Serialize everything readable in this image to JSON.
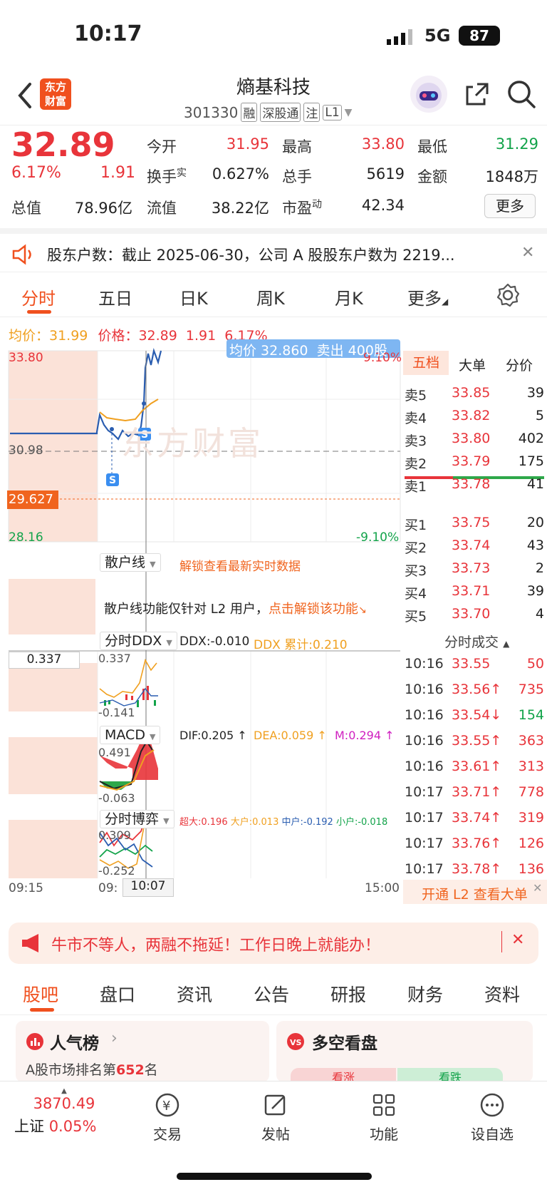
{
  "status_bar": {
    "time": "10:17",
    "network": "5G",
    "battery": "87"
  },
  "header": {
    "title": "熵基科技",
    "code": "301330",
    "tags": [
      "融",
      "深股通",
      "注",
      "L1"
    ],
    "logo_line1": "东方",
    "logo_line2": "财富"
  },
  "quote": {
    "price": "32.89",
    "change_pct": "6.17%",
    "change": "1.91",
    "fields": [
      {
        "label": "今开",
        "value": "31.95"
      },
      {
        "label": "最高",
        "value": "33.80"
      },
      {
        "label": "最低",
        "value": "31.29"
      },
      {
        "label": "换手",
        "sup": "实",
        "value": "0.627%"
      },
      {
        "label": "总手",
        "value": "5619"
      },
      {
        "label": "金额",
        "value": "1848万"
      },
      {
        "label": "总值",
        "value": "78.96亿"
      },
      {
        "label": "流值",
        "value": "38.22亿"
      },
      {
        "label": "市盈",
        "sup": "动",
        "value": "42.34"
      }
    ],
    "more_label": "更多"
  },
  "notice": {
    "text": "股东户数：截止 2025-06-30，公司 A 股股东户数为 2219..."
  },
  "chart_tabs": [
    "分时",
    "五日",
    "日K",
    "周K",
    "月K",
    "更多"
  ],
  "chart": {
    "avg_label": "均价：31.99",
    "price_label": "价格：32.89",
    "change": "1.91",
    "change_pct": "6.17%",
    "y_high": "33.80",
    "y_mid": "30.98",
    "y_low": "28.16",
    "pct_high": "9.10%",
    "pct_low": "-9.10%",
    "marker_price": "29.627",
    "tooltip": "均价 32.860  卖出 400股",
    "watermark": "东方财富",
    "retail_line_label": "散户线",
    "retail_unlock": "解锁查看最新实时数据",
    "retail_msg": "散户线功能仅针对 L2 用户，",
    "retail_msg_link": "点击解锁该功能",
    "ddx_label": "分时DDX",
    "ddx_value": "DDX:-0.010",
    "ddx_sum": "DDX 累计:0.210",
    "ddx_top": "0.337",
    "ddx_bottom": "-0.141",
    "macd_label": "MACD",
    "dif": "DIF:0.205 ↑",
    "dea": "DEA:0.059 ↑",
    "m": "M:0.294 ↑",
    "macd_top": "0.491",
    "macd_bottom": "-0.063",
    "game_label": "分时博弈",
    "game_values": [
      {
        "text": "超大:0.196",
        "color": "#e8343a"
      },
      {
        "text": "大户:0.013",
        "color": "#f0a020"
      },
      {
        "text": "中户:-0.192",
        "color": "#2a5db0"
      },
      {
        "text": "小户:-0.018",
        "color": "#12a34a"
      }
    ],
    "game_top": "0.309",
    "game_bottom": "-0.252",
    "time_start": "09:15",
    "time_mid": "09:",
    "time_cursor": "10:07",
    "time_end": "15:00"
  },
  "orderbook": {
    "tabs": [
      "五档",
      "大单",
      "分价"
    ],
    "sells": [
      {
        "label": "卖5",
        "price": "33.85",
        "vol": "39"
      },
      {
        "label": "卖4",
        "price": "33.82",
        "vol": "5"
      },
      {
        "label": "卖3",
        "price": "33.80",
        "vol": "402"
      },
      {
        "label": "卖2",
        "price": "33.79",
        "vol": "175"
      },
      {
        "label": "卖1",
        "price": "33.78",
        "vol": "41"
      }
    ],
    "buys": [
      {
        "label": "买1",
        "price": "33.75",
        "vol": "20"
      },
      {
        "label": "买2",
        "price": "33.74",
        "vol": "43"
      },
      {
        "label": "买3",
        "price": "33.73",
        "vol": "2"
      },
      {
        "label": "买4",
        "price": "33.71",
        "vol": "39"
      },
      {
        "label": "买5",
        "price": "33.70",
        "vol": "4"
      }
    ],
    "trades_title": "分时成交",
    "trades": [
      {
        "time": "10:16",
        "price": "33.55",
        "vol": "50",
        "vc": "red"
      },
      {
        "time": "10:16",
        "price": "33.56↑",
        "vol": "735",
        "vc": "red"
      },
      {
        "time": "10:16",
        "price": "33.54↓",
        "vol": "154",
        "vc": "green"
      },
      {
        "time": "10:16",
        "price": "33.55↑",
        "vol": "363",
        "vc": "red"
      },
      {
        "time": "10:16",
        "price": "33.61↑",
        "vol": "313",
        "vc": "red"
      },
      {
        "time": "10:17",
        "price": "33.71↑",
        "vol": "778",
        "vc": "red"
      },
      {
        "time": "10:17",
        "price": "33.74↑",
        "vol": "319",
        "vc": "red"
      },
      {
        "time": "10:17",
        "price": "33.76↑",
        "vol": "126",
        "vc": "red"
      },
      {
        "time": "10:17",
        "price": "33.78↑",
        "vol": "136",
        "vc": "red"
      }
    ],
    "l2_label": "开通 L2 查看大单"
  },
  "promo": {
    "text": "牛市不等人，两融不拖延！工作日晚上就能办！"
  },
  "bottom_tabs": [
    "股吧",
    "盘口",
    "资讯",
    "公告",
    "研报",
    "财务",
    "资料"
  ],
  "cards": {
    "popularity_title": "人气榜",
    "popularity_rank_prefix": "A股市场排名第",
    "popularity_rank": "652",
    "popularity_rank_suffix": "名",
    "bullbear_title": "多空看盘",
    "bull_label": "看涨",
    "bear_label": "看跌"
  },
  "bottom_nav": {
    "index_value": "3870.49",
    "index_name": "上证",
    "index_change": "0.05%",
    "items": [
      "交易",
      "发帖",
      "功能",
      "设自选"
    ]
  }
}
